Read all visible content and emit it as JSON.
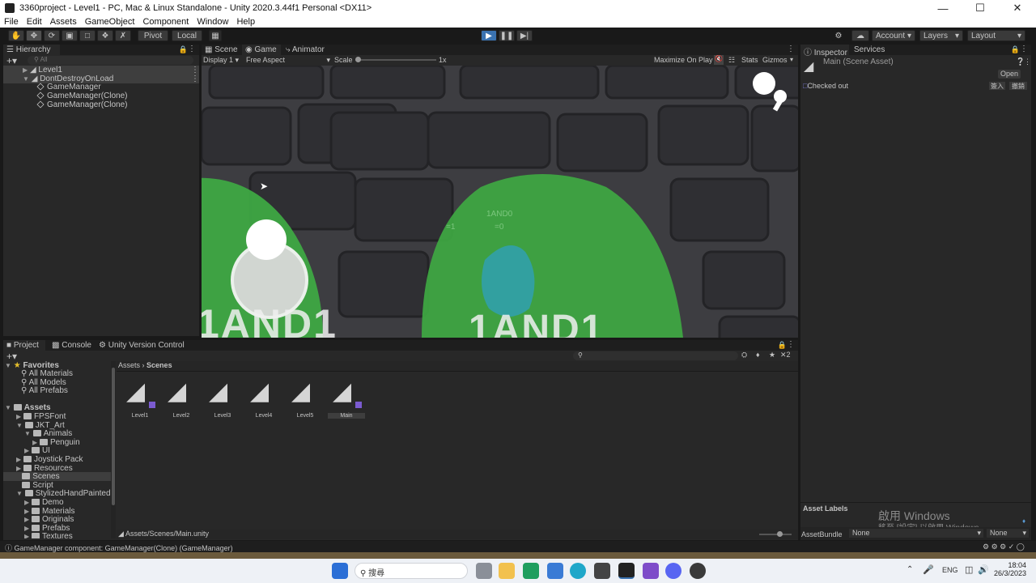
{
  "window": {
    "title": "3360project - Level1 - PC, Mac & Linux Standalone - Unity 2020.3.44f1 Personal <DX11>"
  },
  "menu": [
    "File",
    "Edit",
    "Assets",
    "GameObject",
    "Component",
    "Window",
    "Help"
  ],
  "toolbar": {
    "pivot": "Pivot",
    "local": "Local",
    "account": "Account",
    "layers": "Layers",
    "layout": "Layout"
  },
  "hierarchy": {
    "tab": "Hierarchy",
    "search_placeholder": "All",
    "items": [
      {
        "label": "Level1",
        "depth": 1
      },
      {
        "label": "DontDestroyOnLoad",
        "depth": 1
      },
      {
        "label": "GameManager",
        "depth": 2
      },
      {
        "label": "GameManager(Clone)",
        "depth": 2
      },
      {
        "label": "GameManager(Clone)",
        "depth": 2
      }
    ]
  },
  "game": {
    "tabs": [
      "Scene",
      "Game",
      "Animator"
    ],
    "display": "Display 1",
    "aspect": "Free Aspect",
    "scale_label": "Scale",
    "scale_value": "1x",
    "maximize": "Maximize On Play",
    "stats": "Stats",
    "gizmos": "Gizmos",
    "left_sign": "1AND1",
    "right_sign": "1AND1",
    "faint_text": "1AND0",
    "faint_eq1": "=0",
    "faint_eq2": "=1"
  },
  "inspector": {
    "tabs": [
      "Inspector",
      "Services"
    ],
    "asset": "Main (Scene Asset)",
    "open_button": "Open",
    "checked_out": "Checked out",
    "btn1": "簽入",
    "btn2": "撤銷",
    "asset_labels": "Asset Labels",
    "asset_bundle": "AssetBundle",
    "bundle_value": "None",
    "variant_value": "None",
    "watermark1": "啟用 Windows",
    "watermark2": "移至 [設定] 以啟用 Windows。"
  },
  "project": {
    "tabs": [
      "Project",
      "Console",
      "Unity Version Control"
    ],
    "favorites_label": "Favorites",
    "favorites": [
      "All Materials",
      "All Models",
      "All Prefabs"
    ],
    "assets_label": "Assets",
    "tree": [
      {
        "label": "FPSFont",
        "depth": 1
      },
      {
        "label": "JKT_Art",
        "depth": 1
      },
      {
        "label": "Animals",
        "depth": 2
      },
      {
        "label": "Penguin",
        "depth": 3
      },
      {
        "label": "UI",
        "depth": 2
      },
      {
        "label": "Joystick Pack",
        "depth": 1
      },
      {
        "label": "Resources",
        "depth": 1
      },
      {
        "label": "Scenes",
        "depth": 1
      },
      {
        "label": "Script",
        "depth": 1
      },
      {
        "label": "StylizedHandPaintedDung",
        "depth": 1
      },
      {
        "label": "Demo",
        "depth": 2
      },
      {
        "label": "Materials",
        "depth": 2
      },
      {
        "label": "Originals",
        "depth": 2
      },
      {
        "label": "Prefabs",
        "depth": 2
      },
      {
        "label": "Textures",
        "depth": 2
      }
    ],
    "breadcrumb": [
      "Assets",
      "Scenes"
    ],
    "scenes": [
      "Level1",
      "Level2",
      "Level3",
      "Level4",
      "Level5",
      "Main"
    ],
    "footer_path": "Assets/Scenes/Main.unity",
    "hidden_count": "2"
  },
  "status": {
    "message": "GameManager component: GameManager(Clone) (GameManager)"
  },
  "taskbar": {
    "search": "搜尋",
    "lang": "ENG",
    "time": "18:04",
    "date": "26/3/2023"
  },
  "colors": {
    "accent": "#3a72b0",
    "green": "#3ea843",
    "stone": "#3a3a3e"
  }
}
